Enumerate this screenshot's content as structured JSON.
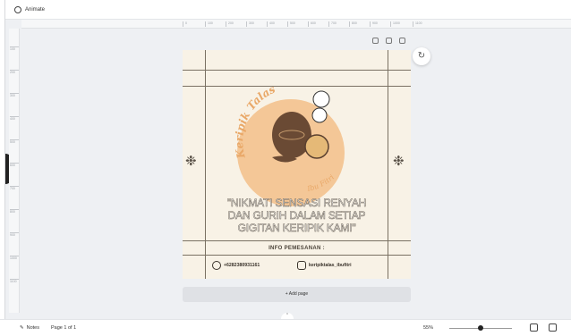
{
  "topbar": {
    "animate_label": "Animate"
  },
  "ruler": {
    "h_ticks": [
      "0",
      "100",
      "200",
      "300",
      "400",
      "500",
      "600",
      "700",
      "800",
      "900",
      "1000",
      "1100"
    ],
    "v_ticks": [
      "100",
      "200",
      "300",
      "400",
      "500",
      "600",
      "700",
      "800",
      "900",
      "1000",
      "1100"
    ]
  },
  "design": {
    "brand_arc": "Keripik Talas",
    "brand_sub": "Ibu Fitri",
    "tagline_1": "\"NIKMATI SENSASI RENYAH",
    "tagline_2": "DAN GURIH DALAM SETIAP",
    "tagline_3": "GIGITAN KERIPIK KAMI\"",
    "info_title": "INFO PEMESANAN :",
    "phone": "+6282380931161",
    "instagram": "keripiktalas_ibufitri",
    "colors": {
      "background": "#f8f2e6",
      "accent": "#f3c28e",
      "ink": "#5a5248"
    }
  },
  "add_page_label": "+ Add page",
  "bottombar": {
    "notes_label": "Notes",
    "page_label": "Page 1 of 1",
    "zoom": "55%"
  }
}
